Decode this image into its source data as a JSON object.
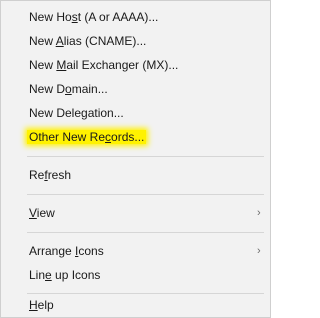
{
  "menu": {
    "items": [
      {
        "pre": "New Ho",
        "u": "s",
        "post": "t (A or AAAA)..."
      },
      {
        "pre": "New ",
        "u": "A",
        "post": "lias (CNAME)..."
      },
      {
        "pre": "New ",
        "u": "M",
        "post": "ail Exchanger (MX)..."
      },
      {
        "pre": "New D",
        "u": "o",
        "post": "main..."
      },
      {
        "pre": "New Delegation...",
        "u": "",
        "post": ""
      },
      {
        "pre": "Other New Re",
        "u": "c",
        "post": "ords..."
      },
      {
        "pre": "Re",
        "u": "f",
        "post": "resh"
      },
      {
        "pre": "",
        "u": "V",
        "post": "iew"
      },
      {
        "pre": "Arrange ",
        "u": "I",
        "post": "cons"
      },
      {
        "pre": "Lin",
        "u": "e",
        "post": " up Icons"
      },
      {
        "pre": "",
        "u": "H",
        "post": "elp"
      }
    ],
    "submenu_arrow": "›",
    "highlight_color": "#fff200"
  }
}
